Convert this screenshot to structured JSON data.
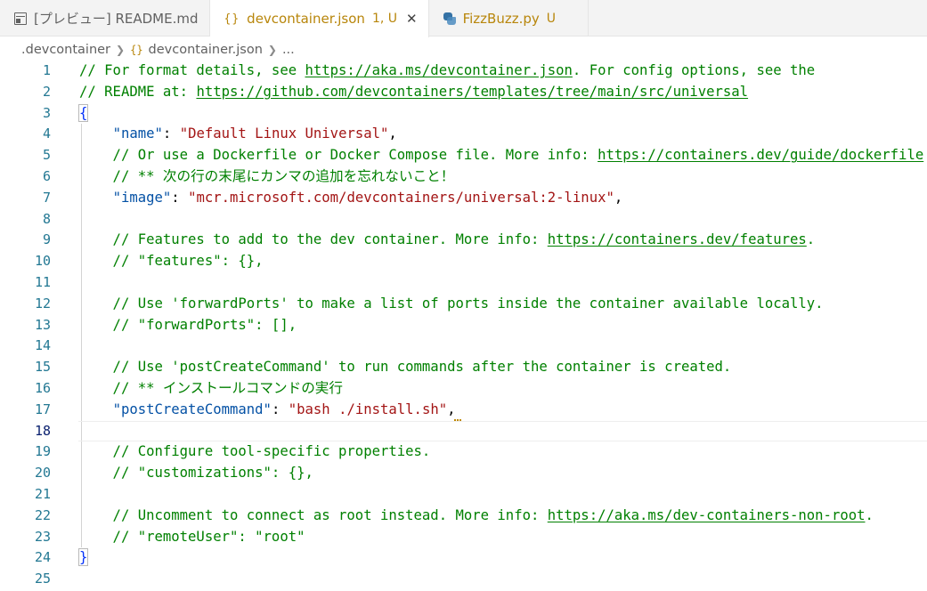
{
  "tabs": [
    {
      "label": "[プレビュー] README.md",
      "status": "",
      "icon": "preview-icon",
      "active": false
    },
    {
      "label": "devcontainer.json",
      "status": "1, U",
      "icon": "braces-icon",
      "active": true,
      "icon_text": "{}",
      "close": "✕"
    },
    {
      "label": "FizzBuzz.py",
      "status": "U",
      "icon": "python-icon",
      "active": false
    }
  ],
  "breadcrumb": {
    "folder": ".devcontainer",
    "file": "devcontainer.json",
    "file_icon_text": "{}",
    "more": "..."
  },
  "colors": {
    "comment": "#008000",
    "key": "#0451a5",
    "string": "#a31515",
    "line_number": "#237893",
    "tab_status": "#b8860b"
  },
  "editor": {
    "current_line": 18,
    "lines": [
      {
        "n": "1",
        "tokens": [
          [
            "c-comment",
            "// For format details, see "
          ],
          [
            "c-link",
            "https://aka.ms/devcontainer.json"
          ],
          [
            "c-comment",
            ". For config options, see the"
          ]
        ]
      },
      {
        "n": "2",
        "tokens": [
          [
            "c-comment",
            "// README at: "
          ],
          [
            "c-link",
            "https://github.com/devcontainers/templates/tree/main/src/universal"
          ]
        ]
      },
      {
        "n": "3",
        "tokens": [
          [
            "c-brace",
            "{"
          ]
        ]
      },
      {
        "n": "4",
        "tokens": [
          [
            "c-punc",
            "    "
          ],
          [
            "c-key",
            "\"name\""
          ],
          [
            "c-punc",
            ": "
          ],
          [
            "c-str",
            "\"Default Linux Universal\""
          ],
          [
            "c-punc",
            ","
          ]
        ]
      },
      {
        "n": "5",
        "tokens": [
          [
            "c-comment",
            "    // Or use a Dockerfile or Docker Compose file. More info: "
          ],
          [
            "c-link",
            "https://containers.dev/guide/dockerfile"
          ]
        ]
      },
      {
        "n": "6",
        "tokens": [
          [
            "c-comment",
            "    // ** 次の行の末尾にカンマの追加を忘れないこと！"
          ]
        ]
      },
      {
        "n": "7",
        "tokens": [
          [
            "c-punc",
            "    "
          ],
          [
            "c-key",
            "\"image\""
          ],
          [
            "c-punc",
            ": "
          ],
          [
            "c-str",
            "\"mcr.microsoft.com/devcontainers/universal:2-linux\""
          ],
          [
            "c-punc",
            ","
          ]
        ]
      },
      {
        "n": "8",
        "tokens": []
      },
      {
        "n": "9",
        "tokens": [
          [
            "c-comment",
            "    // Features to add to the dev container. More info: "
          ],
          [
            "c-link",
            "https://containers.dev/features"
          ],
          [
            "c-comment",
            "."
          ]
        ]
      },
      {
        "n": "10",
        "tokens": [
          [
            "c-comment",
            "    // \"features\": {},"
          ]
        ]
      },
      {
        "n": "11",
        "tokens": []
      },
      {
        "n": "12",
        "tokens": [
          [
            "c-comment",
            "    // Use 'forwardPorts' to make a list of ports inside the container available locally."
          ]
        ]
      },
      {
        "n": "13",
        "tokens": [
          [
            "c-comment",
            "    // \"forwardPorts\": [],"
          ]
        ]
      },
      {
        "n": "14",
        "tokens": []
      },
      {
        "n": "15",
        "tokens": [
          [
            "c-comment",
            "    // Use 'postCreateCommand' to run commands after the container is created."
          ]
        ]
      },
      {
        "n": "16",
        "tokens": [
          [
            "c-comment",
            "    // ** インストールコマンドの実行"
          ]
        ]
      },
      {
        "n": "17",
        "tokens": [
          [
            "c-punc",
            "    "
          ],
          [
            "c-key",
            "\"postCreateCommand\""
          ],
          [
            "c-punc",
            ": "
          ],
          [
            "c-str",
            "\"bash ./install.sh\""
          ],
          [
            "c-punc",
            ","
          ]
        ],
        "squiggle": true
      },
      {
        "n": "18",
        "tokens": []
      },
      {
        "n": "19",
        "tokens": [
          [
            "c-comment",
            "    // Configure tool-specific properties."
          ]
        ]
      },
      {
        "n": "20",
        "tokens": [
          [
            "c-comment",
            "    // \"customizations\": {},"
          ]
        ]
      },
      {
        "n": "21",
        "tokens": []
      },
      {
        "n": "22",
        "tokens": [
          [
            "c-comment",
            "    // Uncomment to connect as root instead. More info: "
          ],
          [
            "c-link",
            "https://aka.ms/dev-containers-non-root"
          ],
          [
            "c-comment",
            "."
          ]
        ]
      },
      {
        "n": "23",
        "tokens": [
          [
            "c-comment",
            "    // \"remoteUser\": \"root\""
          ]
        ]
      },
      {
        "n": "24",
        "tokens": [
          [
            "c-brace",
            "}"
          ]
        ]
      },
      {
        "n": "25",
        "tokens": []
      }
    ]
  }
}
